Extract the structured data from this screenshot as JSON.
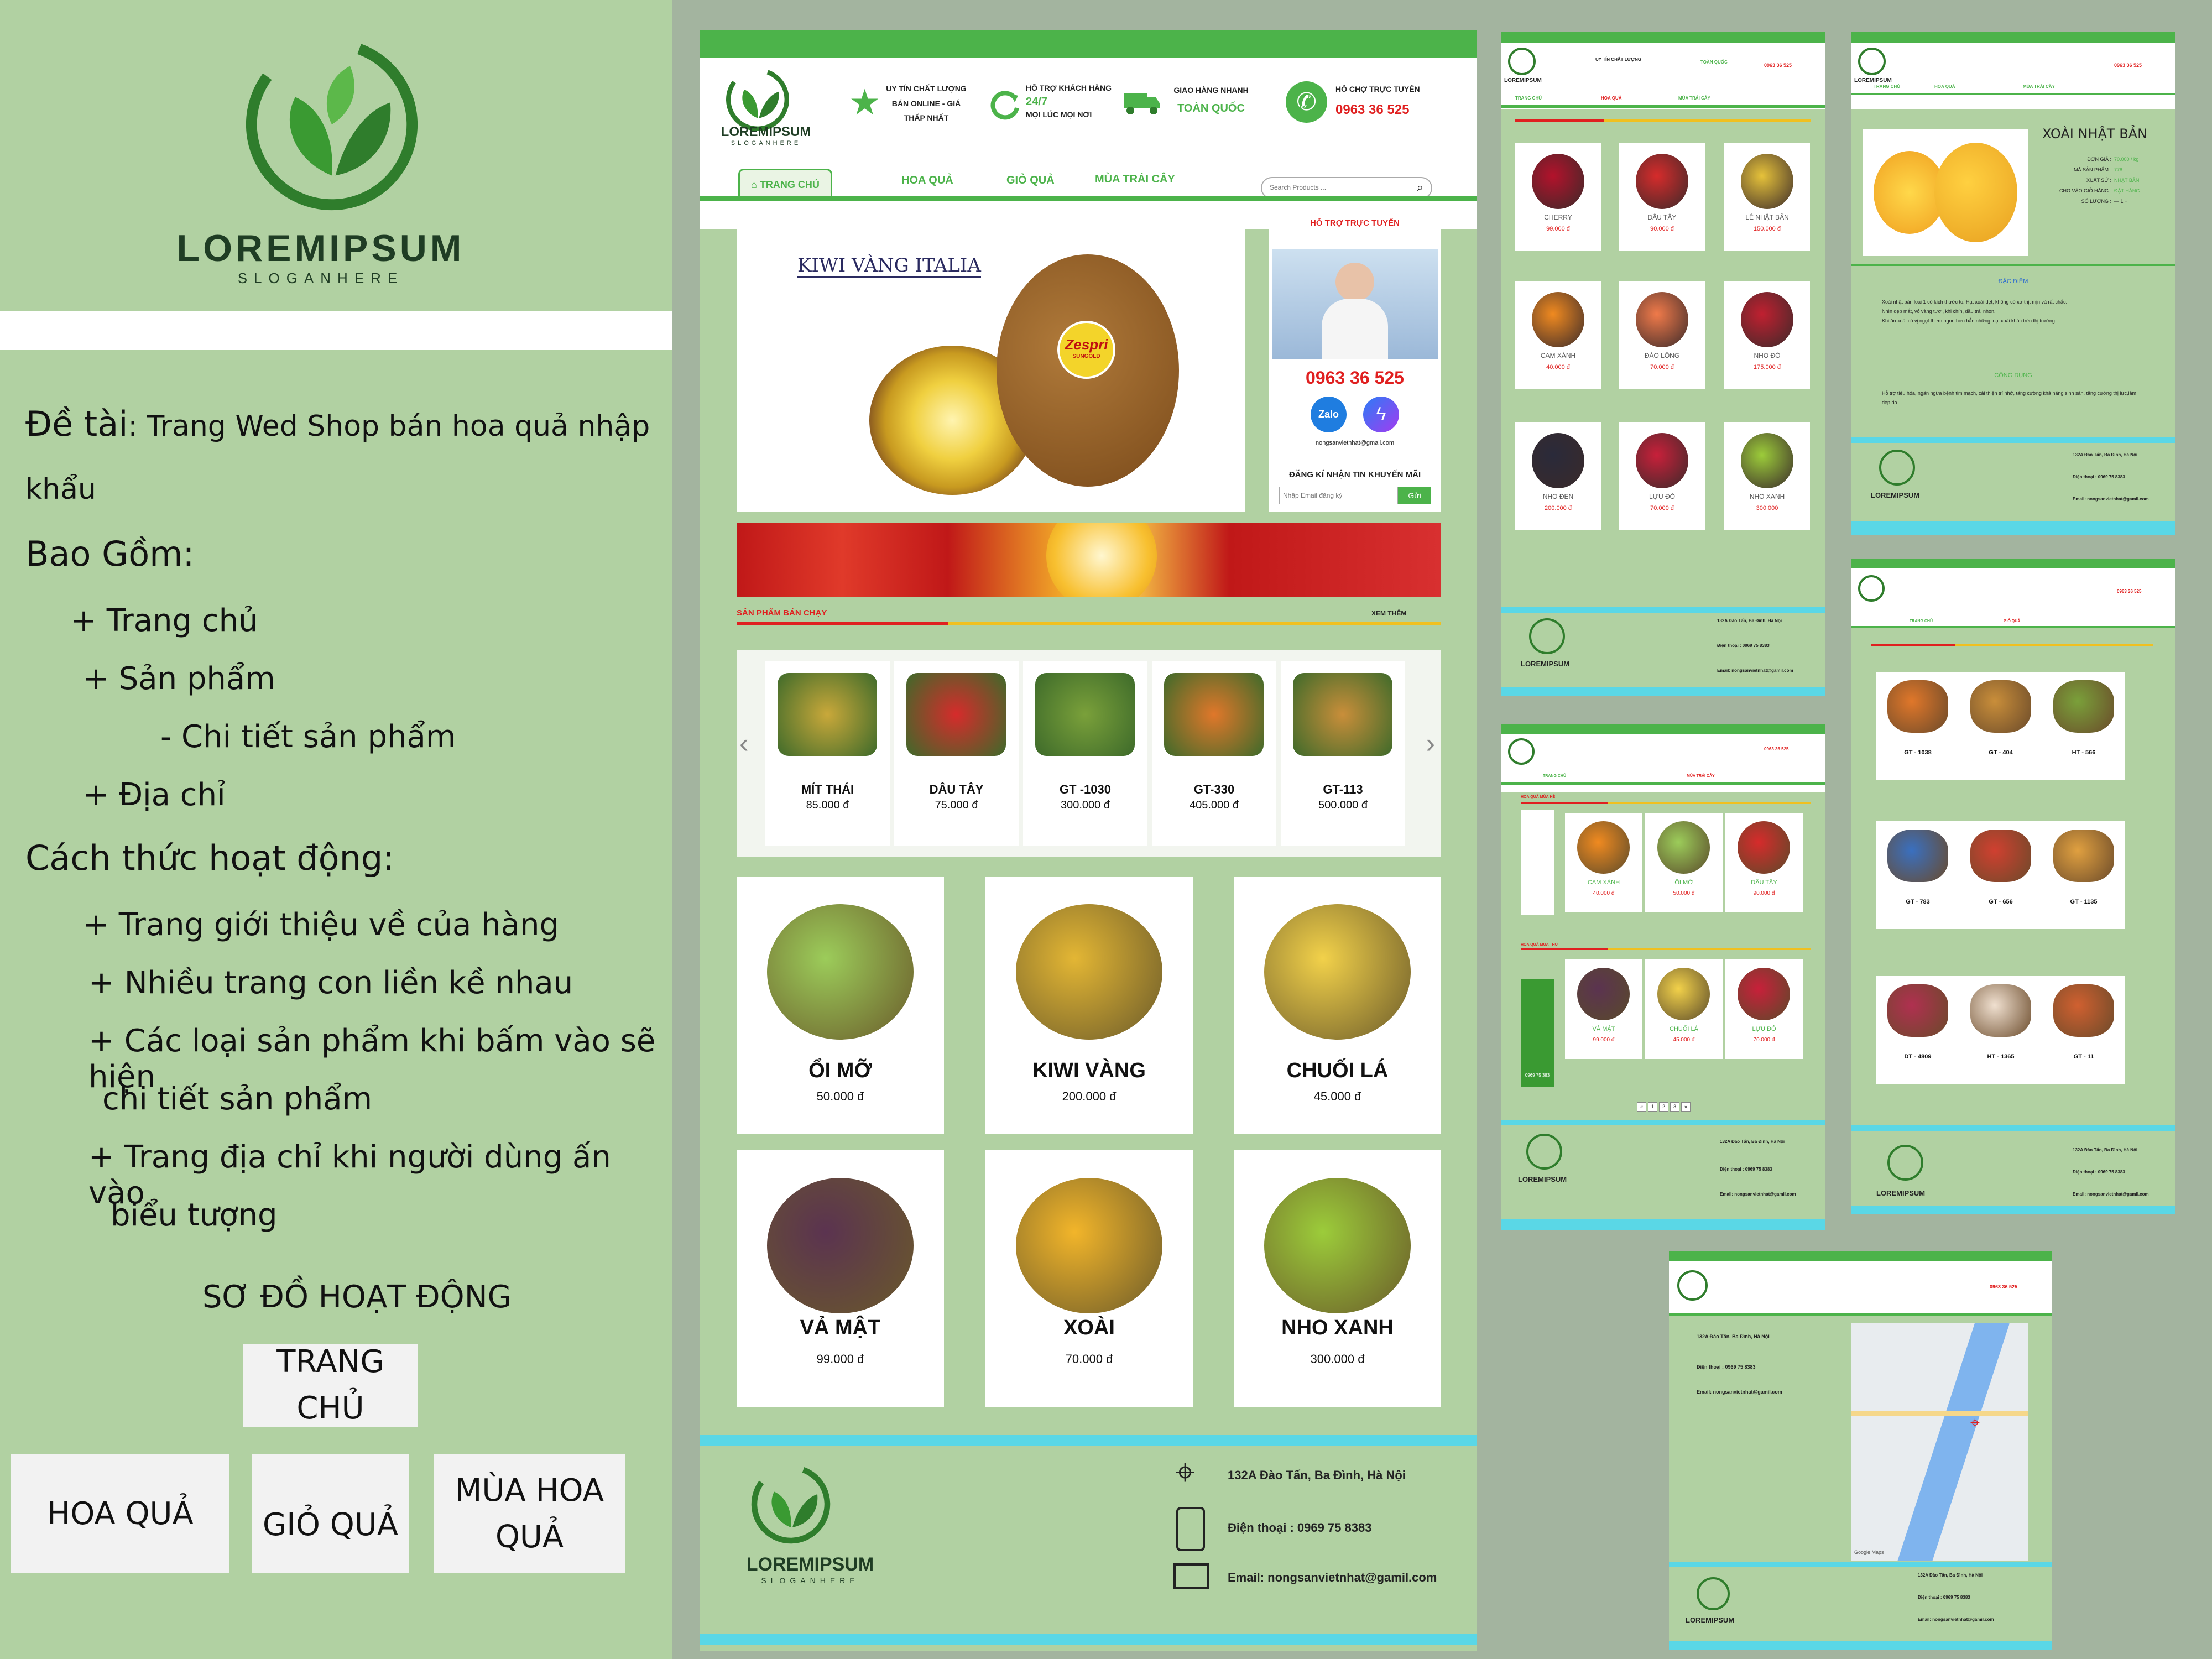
{
  "brand": {
    "name": "LOREMIPSUM",
    "slogan": "SLOGANHERE"
  },
  "info": {
    "topic_label": "Đề tài",
    "topic_text": ": Trang Wed Shop bán hoa quả nhập",
    "topic_text2": "khẩu",
    "includes_title": "Bao Gồm:",
    "includes": [
      "+ Trang chủ",
      "+ Sản phẩm",
      "- Chi tiết sản phẩm",
      "+ Địa chỉ"
    ],
    "how_title": "Cách thức hoạt động:",
    "how": [
      "+ Trang giới thiệu về của hàng",
      "+ Nhiều trang con liền kề nhau",
      "+ Các loại sản phẩm khi bấm vào sẽ hiện",
      "chi tiết sản phẩm",
      "+ Trang địa chỉ khi người dùng ấn vào",
      "biểu tượng"
    ],
    "diagram_title": "SƠ ĐỒ HOẠT ĐỘNG",
    "diagram_root": "TRANG CHỦ",
    "diagram_children": [
      "HOA QUẢ",
      "GIỎ QUẢ",
      "MÙA HOA QUẢ"
    ]
  },
  "header": {
    "features": [
      {
        "line1": "UY TÍN CHẤT LƯỢNG",
        "line2": "BÁN ONLINE - GIÁ",
        "line3": "THẤP NHẤT",
        "icon": "star-icon"
      },
      {
        "line1": "HỖ TRỢ KHÁCH HÀNG",
        "line2": "24/7",
        "line3": "MỌI LÚC MỌI NƠI",
        "icon": "refresh-icon"
      },
      {
        "line1": "GIAO HÀNG NHANH",
        "line2": "TOÀN QUỐC",
        "icon": "truck-icon"
      },
      {
        "line1": "HỖ CHỢ TRỰC TUYẾN",
        "line2": "0963 36 525",
        "icon": "phone-icon"
      }
    ],
    "nav": [
      "TRANG CHỦ",
      "HOA QUẢ",
      "GIỎ QUẢ",
      "MÙA TRÁI CÂY"
    ],
    "search_placeholder": "Search Products ..."
  },
  "hero": {
    "title": "KIWI VÀNG ITALIA",
    "sticker": "Zespri",
    "sticker_sub": "SUNGOLD"
  },
  "support": {
    "title": "HỖ TRỢ TRỰC TUYẾN",
    "phone": "0963 36 525",
    "zalo": "Zalo",
    "email": "nongsanvietnhat@gmail.com",
    "promo_title": "ĐĂNG KÍ NHẬN TIN KHUYẾN MÃI",
    "promo_placeholder": "Nhập Email đăng ký",
    "promo_button": "Gửi"
  },
  "bestseller": {
    "title": "SẢN PHẨM BÁN CHẠY",
    "more": "XEM THÊM",
    "items": [
      {
        "name": "MÍT THÁI",
        "price": "85.000 đ",
        "color": "#c9a83a"
      },
      {
        "name": "DÂU TÂY",
        "price": "75.000 đ",
        "color": "#d62b2b"
      },
      {
        "name": "GT -1030",
        "price": "300.000 đ",
        "color": "#7aa03a"
      },
      {
        "name": "GT-330",
        "price": "405.000 đ",
        "color": "#e0772a"
      },
      {
        "name": "GT-113",
        "price": "500.000 đ",
        "color": "#c98e3a"
      }
    ]
  },
  "grid": [
    {
      "name": "ỔI MỠ",
      "price": "50.000 đ",
      "color": "#9ccc5a"
    },
    {
      "name": "KIWI VÀNG",
      "price": "200.000 đ",
      "color": "#e3b634"
    },
    {
      "name": "CHUỐI LÁ",
      "price": "45.000 đ",
      "color": "#f2d14a"
    },
    {
      "name": "VẢ MẬT",
      "price": "99.000 đ",
      "color": "#5b3350"
    },
    {
      "name": "XOÀI",
      "price": "70.000 đ",
      "color": "#f2b52a"
    },
    {
      "name": "NHO XANH",
      "price": "300.000 đ",
      "color": "#9ccc3a"
    }
  ],
  "footer": {
    "address": "132A Đào Tấn, Ba Đình, Hà Nội",
    "phone": "Điện thoại : 0969 75 8383",
    "email": "Email: nongsanvietnhat@gamil.com"
  },
  "products_page": {
    "items": [
      {
        "name": "CHERRY",
        "price": "99.000 đ",
        "color": "#b3122b"
      },
      {
        "name": "DÂU TÂY",
        "price": "90.000 đ",
        "color": "#d62b2b"
      },
      {
        "name": "LÊ NHẬT BẢN",
        "price": "150.000 đ",
        "color": "#e6c23a"
      },
      {
        "name": "CAM XÀNH",
        "price": "40.000 đ",
        "color": "#f08a20"
      },
      {
        "name": "ĐÀO LÔNG",
        "price": "70.000 đ",
        "color": "#f07a4a"
      },
      {
        "name": "NHO ĐỎ",
        "price": "175.000 đ",
        "color": "#c02030"
      },
      {
        "name": "NHO ĐEN",
        "price": "200.000 đ",
        "color": "#2a2a3a"
      },
      {
        "name": "LỰU ĐỎ",
        "price": "70.000 đ",
        "color": "#c8203a"
      },
      {
        "name": "NHO XANH",
        "price": "300.000",
        "color": "#9ccc3a"
      }
    ]
  },
  "detail_page": {
    "title": "XOÀI NHẬT BẢN",
    "rows": [
      {
        "k": "ĐƠN GIÁ :",
        "v": "70.000 / kg"
      },
      {
        "k": "MÃ SẢN PHẨM :",
        "v": "778"
      },
      {
        "k": "XUẤT SỨ :",
        "v": "NHẬT BẢN"
      },
      {
        "k": "CHO VÀO GIỎ HÀNG :",
        "v": "ĐẶT HÀNG"
      },
      {
        "k": "SỐ LƯỢNG :",
        "v": "— 1 +"
      }
    ],
    "section1": "ĐẶC ĐIỂM",
    "desc1": "Xoài nhật bản loại 1 có kích thước to. Hạt xoài dẹt, không có xơ thịt mịn và rất chắc.",
    "desc2": "Nhìn đẹp mắt, vỏ vàng tươi, khi chín, dầu trái nhọn.",
    "desc3": "Khi ăn xoài có vị ngọt thơm ngon hơn hẳn những loại xoài khác trên thị trường.",
    "section2": "CÔNG DỤNG",
    "desc4": "Hỗ trợ tiêu hóa, ngăn ngừa bệnh tim mạch, cải thiện trí nhớ, tăng cường khả năng sinh sản, tăng cường thị lực,làm đẹp da...."
  },
  "season_page": {
    "section1": "HOA QUẢ MÙA HÈ",
    "section2": "HOA QUẢ MÙA THU",
    "summer": [
      {
        "name": "CAM XÀNH",
        "price": "40.000 đ",
        "color": "#f08a20"
      },
      {
        "name": "ỔI MỠ",
        "price": "50.000 đ",
        "color": "#9ccc5a"
      },
      {
        "name": "DÂU TÂY",
        "price": "90.000 đ",
        "color": "#d62b2b"
      }
    ],
    "autumn": [
      {
        "name": "VẢ MẬT",
        "price": "99.000 đ",
        "color": "#5b3350"
      },
      {
        "name": "CHUỐI LÁ",
        "price": "45.000 đ",
        "color": "#f2d14a"
      },
      {
        "name": "LỰU ĐỎ",
        "price": "70.000 đ",
        "color": "#c8203a"
      }
    ],
    "phone_banner": "0969 75 383",
    "pages": [
      "«",
      "1",
      "2",
      "3",
      "»"
    ]
  },
  "basket_page": {
    "items": [
      "GT - 1038",
      "GT - 404",
      "HT - 566",
      "GT - 783",
      "GT - 656",
      "GT - 1135",
      "DT - 4809",
      "HT - 1365",
      "GT - 11"
    ],
    "colors": [
      "#e0772a",
      "#c98e3a",
      "#7aa03a",
      "#3a70c0",
      "#d04030",
      "#e0a040",
      "#b03050",
      "#f0e0d0",
      "#d06030"
    ]
  },
  "map_page": {
    "map_label": "Google Maps"
  }
}
